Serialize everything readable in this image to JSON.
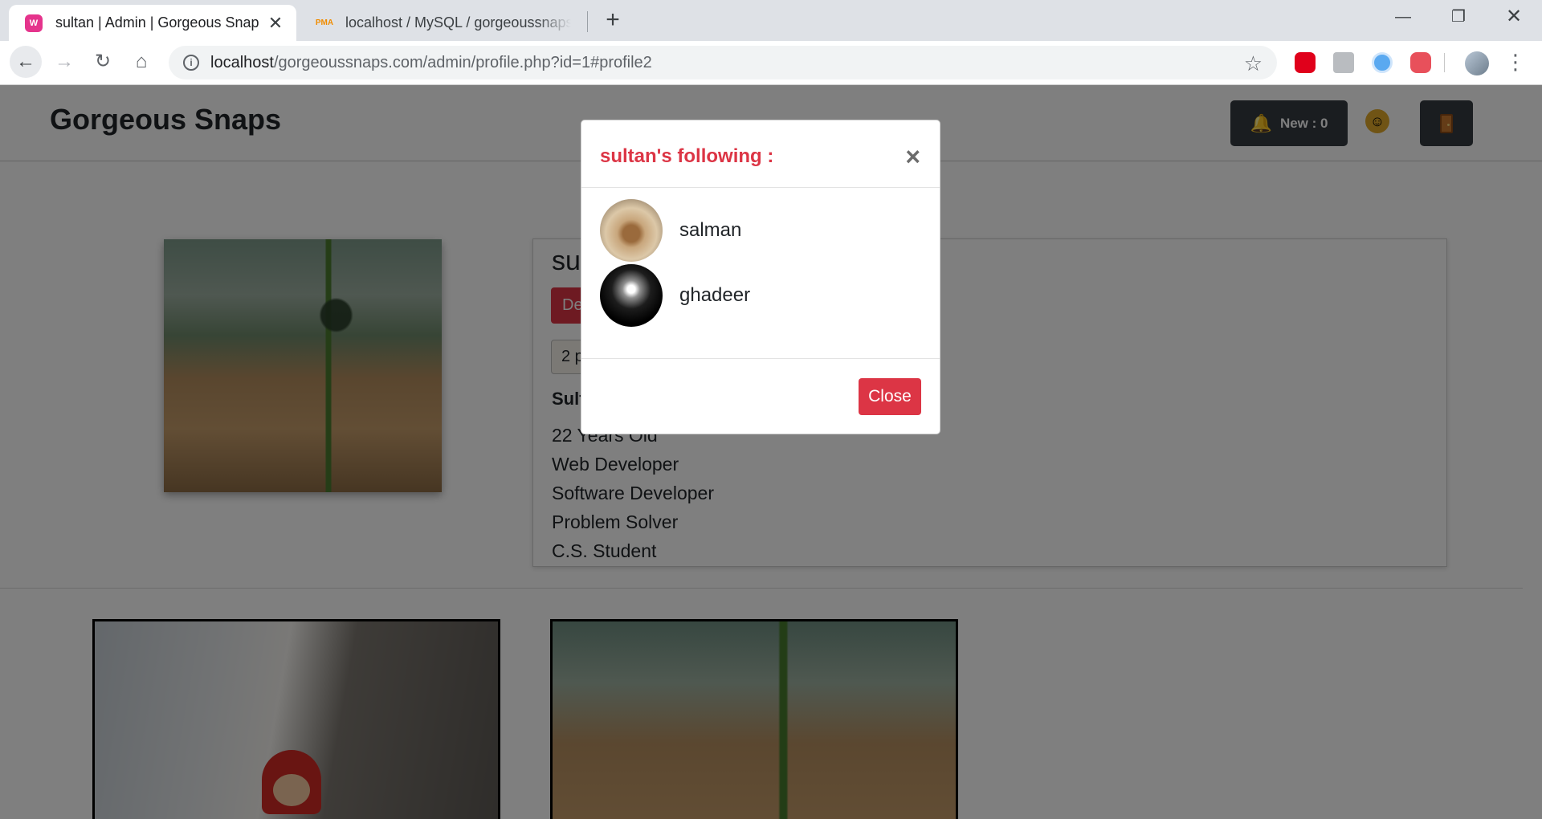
{
  "browser": {
    "tabs": [
      {
        "title": "sultan | Admin | Gorgeous Snaps",
        "active": true,
        "favicon": "wamp-icon"
      },
      {
        "title": "localhost / MySQL / gorgeoussnaps",
        "active": false,
        "favicon": "phpmyadmin-icon"
      }
    ],
    "url_host": "localhost",
    "url_rest": "/gorgeoussnaps.com/admin/profile.php?id=1#profile2"
  },
  "site": {
    "brand": "Gorgeous Snaps",
    "notifications_label": "New : 0"
  },
  "profile": {
    "username": "sultan",
    "delete_label": "Delete",
    "posts_stat": "2 posts",
    "fullname": "Sultan",
    "bio": [
      "22 Years Old",
      "Web Developer",
      "Software Developer",
      "Problem Solver",
      "C.S. Student"
    ]
  },
  "modal": {
    "title": "sultan's following :",
    "close_x": "×",
    "following": [
      {
        "name": "salman"
      },
      {
        "name": "ghadeer"
      }
    ],
    "close_label": "Close"
  }
}
